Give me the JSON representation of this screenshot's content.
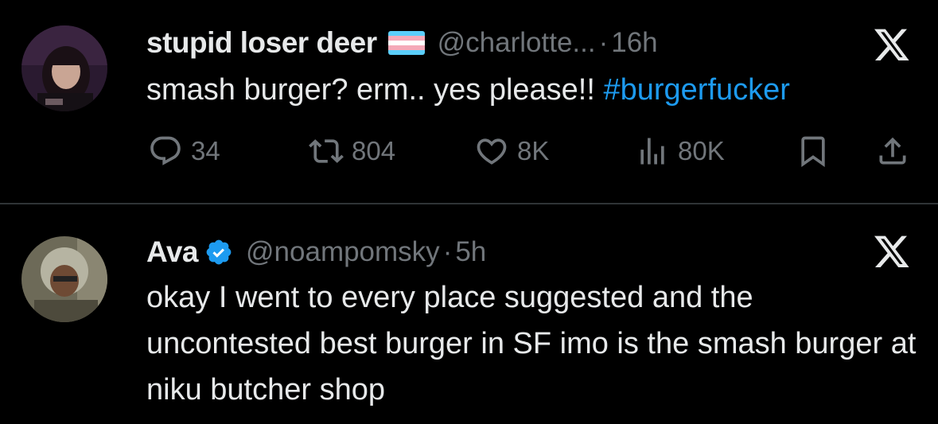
{
  "colors": {
    "background": "#000000",
    "text": "#e7e9ea",
    "secondary": "#71767b",
    "link": "#1d9bf0",
    "divider": "#2f3336"
  },
  "tweets": [
    {
      "name": "stupid loser deer",
      "badge": "trans-flag-emoji",
      "handle": "@charlotte...",
      "separator": "·",
      "time": "16h",
      "text": "smash burger? erm.. yes please!! ",
      "hashtag": "#burgerfucker",
      "stats": {
        "replies": "34",
        "reposts": "804",
        "likes": "8K",
        "views": "80K"
      }
    },
    {
      "name": "Ava",
      "badge": "verified-badge",
      "handle": "@noampomsky",
      "separator": "·",
      "time": "5h",
      "text": "okay I went to every place suggested and the uncontested best burger in SF imo is the smash burger at niku butcher shop"
    }
  ]
}
